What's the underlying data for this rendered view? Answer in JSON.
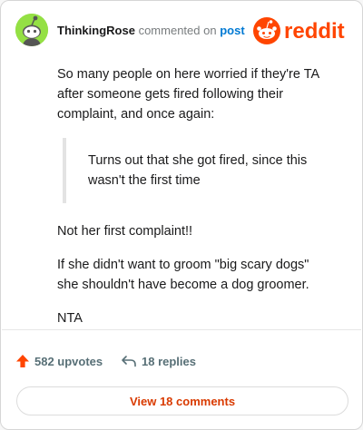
{
  "header": {
    "username": "ThinkingRose",
    "action": "commented on",
    "post_link": "post",
    "brand": "reddit"
  },
  "comment": {
    "paragraphs_before": [
      "So many people on here worried if they're TA after someone gets fired following their complaint, and once again:"
    ],
    "quote": "Turns out that she got fired, since this wasn't the first time",
    "paragraphs_after": [
      "Not her first complaint!!",
      "If she didn't want to groom \"big scary dogs\" she shouldn't have become a dog groomer.",
      "NTA"
    ]
  },
  "footer": {
    "upvotes": "582 upvotes",
    "replies": "18 replies",
    "view_comments": "View 18 comments"
  },
  "colors": {
    "brand": "#ff4500",
    "upvote": "#ff4500",
    "link": "#0079d3",
    "button_text": "#d93a00",
    "avatar_bg": "#94e044"
  },
  "icons": {
    "avatar": "snoo-avatar-icon",
    "logo": "reddit-logo-icon",
    "upvote": "upvote-arrow-icon",
    "reply": "reply-arrow-icon"
  }
}
